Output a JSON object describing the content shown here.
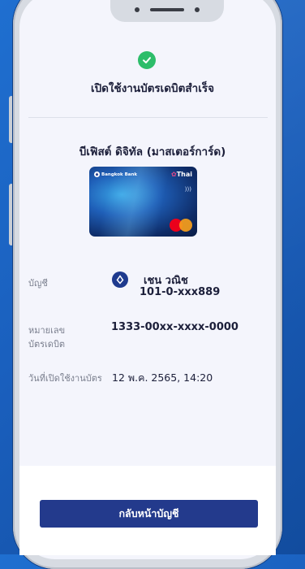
{
  "status": {
    "title": "เปิดใช้งานบัตรเดบิตสำเร็จ"
  },
  "card": {
    "product_name": "บีเฟิสต์ ดิจิทัล (มาสเตอร์การ์ด)",
    "issuer_text": "Bangkok Bank",
    "cobrand_text": "Thai"
  },
  "details": {
    "account_label": "บัญชี",
    "account_name": "เชน วณิช",
    "account_number": "101-0-xxx889",
    "card_number_label_line1": "หมายเลข",
    "card_number_label_line2": "บัตรเดบิต",
    "card_number": "1333-00xx-xxxx-0000",
    "activation_label": "วันที่เปิดใช้งานบัตร",
    "activation_value": "12 พ.ค. 2565, 14:20"
  },
  "actions": {
    "back_button": "กลับหน้าบัญชี"
  },
  "colors": {
    "primary": "#233a8c",
    "success": "#2dbd6a"
  }
}
